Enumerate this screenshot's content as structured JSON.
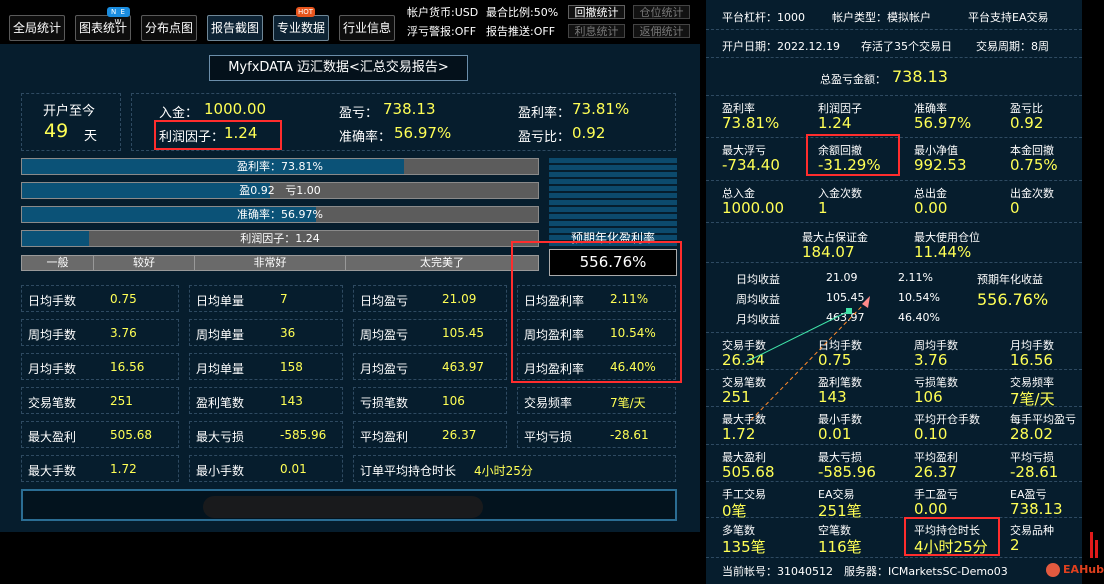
{
  "toolbar": {
    "buttons": [
      "全局统计",
      "图表统计",
      "分布点图",
      "报告截图",
      "专业数据",
      "行业信息"
    ],
    "badge_new": "N E W",
    "badge_hot": "HOT",
    "info_line1_a": "帐户货币:USD",
    "info_line1_b": "最合比例:50%",
    "info_line2_a": "浮亏警报:OFF",
    "info_line2_b": "报告推送:OFF",
    "small_buttons": [
      "回撤统计",
      "仓位统计",
      "利息统计",
      "返佣统计"
    ]
  },
  "left": {
    "title": "MyfxDATA 迈汇数据<汇总交易报告>",
    "since_label": "开户至今",
    "since_days": "49",
    "since_unit": "天",
    "deposit_label": "入金：",
    "deposit_value": "1000.00",
    "profit_label": "盈亏：",
    "profit_value": "738.13",
    "profit_rate_label": "盈利率：",
    "profit_rate_value": "73.81%",
    "pf_label": "利润因子：",
    "pf_value": "1.24",
    "accuracy_label": "准确率：",
    "accuracy_value": "56.97%",
    "pl_ratio_label": "盈亏比：",
    "pl_ratio_value": "0.92",
    "bars": {
      "profit_rate": {
        "text": "盈利率：73.81%",
        "fraction": 0.74
      },
      "win_loss": {
        "win": "盈0.92",
        "loss": "亏1.00",
        "fraction": 0.48
      },
      "accuracy": {
        "text": "准确率：56.97%",
        "fraction": 0.57
      },
      "pf": {
        "text": "利润因子：1.24",
        "fraction": 0.13
      }
    },
    "scale": [
      "一般",
      "较好",
      "非常好",
      "太完美了"
    ],
    "annual_label": "预期年化盈利率",
    "annual_value": "556.76%",
    "grid": [
      [
        {
          "k": "日均手数",
          "v": "0.75"
        },
        {
          "k": "日均单量",
          "v": "7"
        },
        {
          "k": "日均盈亏",
          "v": "21.09"
        },
        {
          "k": "日均盈利率",
          "v": "2.11%"
        }
      ],
      [
        {
          "k": "周均手数",
          "v": "3.76"
        },
        {
          "k": "周均单量",
          "v": "36"
        },
        {
          "k": "周均盈亏",
          "v": "105.45"
        },
        {
          "k": "周均盈利率",
          "v": "10.54%"
        }
      ],
      [
        {
          "k": "月均手数",
          "v": "16.56"
        },
        {
          "k": "月均单量",
          "v": "158"
        },
        {
          "k": "月均盈亏",
          "v": "463.97"
        },
        {
          "k": "月均盈利率",
          "v": "46.40%"
        }
      ],
      [
        {
          "k": "交易笔数",
          "v": "251"
        },
        {
          "k": "盈利笔数",
          "v": "143"
        },
        {
          "k": "亏损笔数",
          "v": "106"
        },
        {
          "k": "交易频率",
          "v": "7笔/天"
        }
      ],
      [
        {
          "k": "最大盈利",
          "v": "505.68"
        },
        {
          "k": "最大亏损",
          "v": "-585.96"
        },
        {
          "k": "平均盈利",
          "v": "26.37"
        },
        {
          "k": "平均亏损",
          "v": "-28.61"
        }
      ]
    ],
    "last_row": {
      "k1": "最大手数",
      "v1": "1.72",
      "k2": "最小手数",
      "v2": "0.01",
      "k3": "订单平均持仓时长",
      "v3": "4小时25分"
    }
  },
  "right": {
    "leverage": "平台杠杆：1000",
    "account_type": "帐户类型：模拟帐户",
    "ea_support": "平台支持EA交易",
    "open_date": "开户日期：2022.12.19",
    "survived": "存活了35个交易日",
    "cycle": "交易周期：8周",
    "total_profit_label": "总盈亏金额：",
    "total_profit_value": "738.13",
    "r1": [
      {
        "k": "盈利率",
        "v": "73.81%"
      },
      {
        "k": "利润因子",
        "v": "1.24"
      },
      {
        "k": "准确率",
        "v": "56.97%"
      },
      {
        "k": "盈亏比",
        "v": "0.92"
      }
    ],
    "r2": [
      {
        "k": "最大浮亏",
        "v": "-734.40"
      },
      {
        "k": "余额回撤",
        "v": "-31.29%"
      },
      {
        "k": "最小净值",
        "v": "992.53"
      },
      {
        "k": "本金回撤",
        "v": "0.75%"
      }
    ],
    "r3": [
      {
        "k": "总入金",
        "v": "1000.00"
      },
      {
        "k": "入金次数",
        "v": "1"
      },
      {
        "k": "总出金",
        "v": "0.00"
      },
      {
        "k": "出金次数",
        "v": "0"
      }
    ],
    "r4": [
      {
        "k": "最大占保证金",
        "v": "184.07"
      },
      {
        "k": "最大使用仓位",
        "v": "11.44%"
      }
    ],
    "returns": [
      {
        "k": "日均收益",
        "a": "21.09",
        "b": "2.11%"
      },
      {
        "k": "周均收益",
        "a": "105.45",
        "b": "10.54%"
      },
      {
        "k": "月均收益",
        "a": "463.97",
        "b": "46.40%"
      }
    ],
    "annual_label": "预期年化收益",
    "annual_value": "556.76%",
    "r5": [
      {
        "k": "交易手数",
        "v": "26.34"
      },
      {
        "k": "日均手数",
        "v": "0.75"
      },
      {
        "k": "周均手数",
        "v": "3.76"
      },
      {
        "k": "月均手数",
        "v": "16.56"
      }
    ],
    "r6": [
      {
        "k": "交易笔数",
        "v": "251"
      },
      {
        "k": "盈利笔数",
        "v": "143"
      },
      {
        "k": "亏损笔数",
        "v": "106"
      },
      {
        "k": "交易频率",
        "v": "7笔/天"
      }
    ],
    "r7": [
      {
        "k": "最大手数",
        "v": "1.72"
      },
      {
        "k": "最小手数",
        "v": "0.01"
      },
      {
        "k": "平均开仓手数",
        "v": "0.10"
      },
      {
        "k": "每手平均盈亏",
        "v": "28.02"
      }
    ],
    "r8": [
      {
        "k": "最大盈利",
        "v": "505.68"
      },
      {
        "k": "最大亏损",
        "v": "-585.96"
      },
      {
        "k": "平均盈利",
        "v": "26.37"
      },
      {
        "k": "平均亏损",
        "v": "-28.61"
      }
    ],
    "r9": [
      {
        "k": "手工交易",
        "v": "0笔"
      },
      {
        "k": "EA交易",
        "v": "251笔"
      },
      {
        "k": "手工盈亏",
        "v": "0.00"
      },
      {
        "k": "EA盈亏",
        "v": "738.13"
      }
    ],
    "r10": [
      {
        "k": "多笔数",
        "v": "135笔"
      },
      {
        "k": "空笔数",
        "v": "116笔"
      },
      {
        "k": "平均持仓时长",
        "v": "4小时25分"
      },
      {
        "k": "交易品种",
        "v": "2"
      }
    ],
    "account_no": "当前帐号：31040512",
    "server": "服务器：ICMarketsSC-Demo03"
  },
  "watermark": "EAHub",
  "colors": {
    "panel": "#061d2d",
    "value": "#ffff55",
    "highlight": "#ff2d2d",
    "bar_fill": "#0b5277"
  }
}
